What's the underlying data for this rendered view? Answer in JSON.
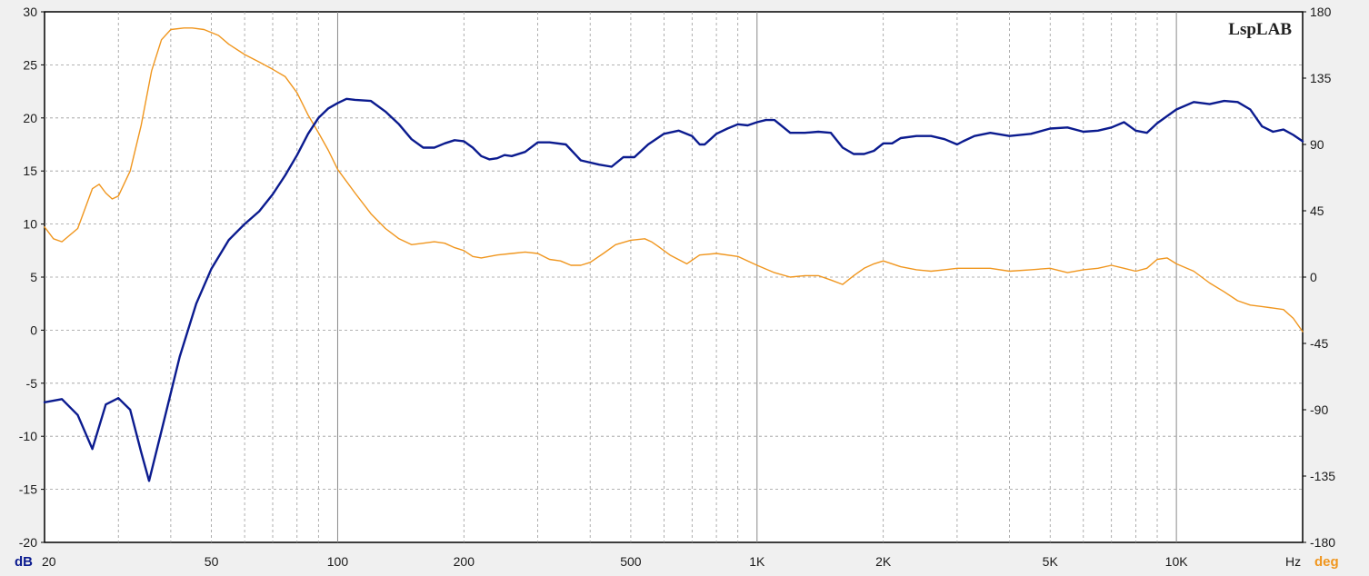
{
  "chart_data": {
    "type": "line",
    "watermark": "LspLAB",
    "colors": {
      "background": "#f0f0f0",
      "plot_background": "#ffffff",
      "magnitude": "#0b1b8f",
      "phase": "#f0961e",
      "grid": "#9a9a9a"
    },
    "x_axis": {
      "scale": "log",
      "range": [
        20,
        20000
      ],
      "unit_label": "Hz",
      "ticks": [
        {
          "value": 20,
          "label": "20"
        },
        {
          "value": 50,
          "label": "50"
        },
        {
          "value": 100,
          "label": "100"
        },
        {
          "value": 200,
          "label": "200"
        },
        {
          "value": 500,
          "label": "500"
        },
        {
          "value": 1000,
          "label": "1K"
        },
        {
          "value": 2000,
          "label": "2K"
        },
        {
          "value": 5000,
          "label": "5K"
        },
        {
          "value": 10000,
          "label": "10K"
        }
      ]
    },
    "y_left": {
      "unit_label": "dB",
      "range": [
        -20,
        30
      ],
      "ticks": [
        30,
        25,
        20,
        15,
        10,
        5,
        0,
        -5,
        -10,
        -15,
        -20
      ]
    },
    "y_right": {
      "unit_label": "deg",
      "range": [
        -180,
        180
      ],
      "ticks": [
        180,
        135,
        90,
        45,
        0,
        -45,
        -90,
        -135,
        -180
      ]
    },
    "series": [
      {
        "key": "magnitude",
        "axis": "left",
        "x": [
          20,
          22,
          24,
          26,
          28,
          30,
          32,
          34,
          35.5,
          38,
          42,
          46,
          50,
          55,
          60,
          65,
          70,
          75,
          80,
          85,
          90,
          95,
          100,
          105,
          110,
          120,
          130,
          140,
          150,
          160,
          170,
          180,
          190,
          200,
          210,
          220,
          230,
          240,
          250,
          260,
          280,
          300,
          320,
          350,
          380,
          420,
          450,
          480,
          510,
          550,
          600,
          650,
          700,
          730,
          750,
          800,
          850,
          900,
          950,
          1000,
          1050,
          1100,
          1200,
          1300,
          1400,
          1500,
          1600,
          1700,
          1800,
          1900,
          2000,
          2100,
          2200,
          2400,
          2600,
          2800,
          3000,
          3100,
          3300,
          3600,
          4000,
          4500,
          5000,
          5500,
          6000,
          6500,
          7000,
          7500,
          8000,
          8500,
          9000,
          10000,
          11000,
          12000,
          13000,
          14000,
          15000,
          16000,
          17000,
          18000,
          19000,
          20000
        ],
        "y": [
          -6.8,
          -6.5,
          -8.0,
          -11.2,
          -7.0,
          -6.4,
          -7.5,
          -11.5,
          -14.2,
          -9.5,
          -2.5,
          2.5,
          5.8,
          8.5,
          10.0,
          11.2,
          12.8,
          14.6,
          16.5,
          18.5,
          20.0,
          20.9,
          21.4,
          21.8,
          21.7,
          21.6,
          20.6,
          19.4,
          18.0,
          17.2,
          17.2,
          17.6,
          17.9,
          17.8,
          17.2,
          16.4,
          16.1,
          16.2,
          16.5,
          16.4,
          16.8,
          17.7,
          17.7,
          17.5,
          16.0,
          15.6,
          15.4,
          16.3,
          16.3,
          17.5,
          18.5,
          18.8,
          18.3,
          17.5,
          17.5,
          18.5,
          19.0,
          19.4,
          19.3,
          19.6,
          19.8,
          19.8,
          18.6,
          18.6,
          18.7,
          18.6,
          17.2,
          16.6,
          16.6,
          16.9,
          17.6,
          17.6,
          18.1,
          18.3,
          18.3,
          18.0,
          17.5,
          17.8,
          18.3,
          18.6,
          18.3,
          18.5,
          19.0,
          19.1,
          18.7,
          18.8,
          19.1,
          19.6,
          18.8,
          18.6,
          19.5,
          20.8,
          21.5,
          21.3,
          21.6,
          21.5,
          20.8,
          19.2,
          18.7,
          18.9,
          18.4,
          17.8
        ]
      },
      {
        "key": "phase",
        "axis": "right",
        "x": [
          20,
          21,
          22,
          24,
          26,
          27,
          28,
          29,
          30,
          32,
          34,
          36,
          38,
          40,
          43,
          45,
          48,
          52,
          55,
          60,
          65,
          70,
          75,
          80,
          85,
          90,
          95,
          100,
          110,
          120,
          130,
          140,
          150,
          160,
          170,
          180,
          190,
          200,
          210,
          220,
          240,
          260,
          280,
          300,
          320,
          340,
          360,
          380,
          400,
          430,
          460,
          500,
          540,
          560,
          580,
          620,
          680,
          730,
          800,
          900,
          1000,
          1100,
          1200,
          1300,
          1400,
          1500,
          1600,
          1700,
          1800,
          1900,
          2000,
          2200,
          2400,
          2600,
          2800,
          3000,
          3300,
          3600,
          4000,
          4500,
          5000,
          5500,
          6000,
          6500,
          7000,
          7500,
          8000,
          8500,
          9000,
          9500,
          10000,
          11000,
          12000,
          13000,
          14000,
          15000,
          16000,
          17000,
          18000,
          19000,
          20000
        ],
        "y": [
          34,
          26,
          24,
          33,
          60,
          63,
          57,
          53,
          55,
          72,
          103,
          140,
          161,
          168,
          169,
          169,
          168,
          164,
          158,
          151,
          146,
          141,
          136,
          125,
          110,
          98,
          86,
          73,
          57,
          43,
          33,
          26,
          22,
          23,
          24,
          23,
          20,
          18,
          14,
          13,
          15,
          16,
          17,
          16,
          12,
          11,
          8,
          8,
          10,
          16,
          22,
          25,
          26,
          24,
          21,
          15,
          9,
          15,
          16,
          14,
          8,
          3,
          0,
          1,
          1,
          -2,
          -5,
          1,
          6,
          9,
          11,
          7,
          5,
          4,
          5,
          6,
          6,
          6,
          4,
          5,
          6,
          3,
          5,
          6,
          8,
          6,
          4,
          6,
          12,
          13,
          9,
          4,
          -4,
          -10,
          -16,
          -19,
          -20,
          -21,
          -22,
          -28,
          -37
        ]
      }
    ]
  }
}
